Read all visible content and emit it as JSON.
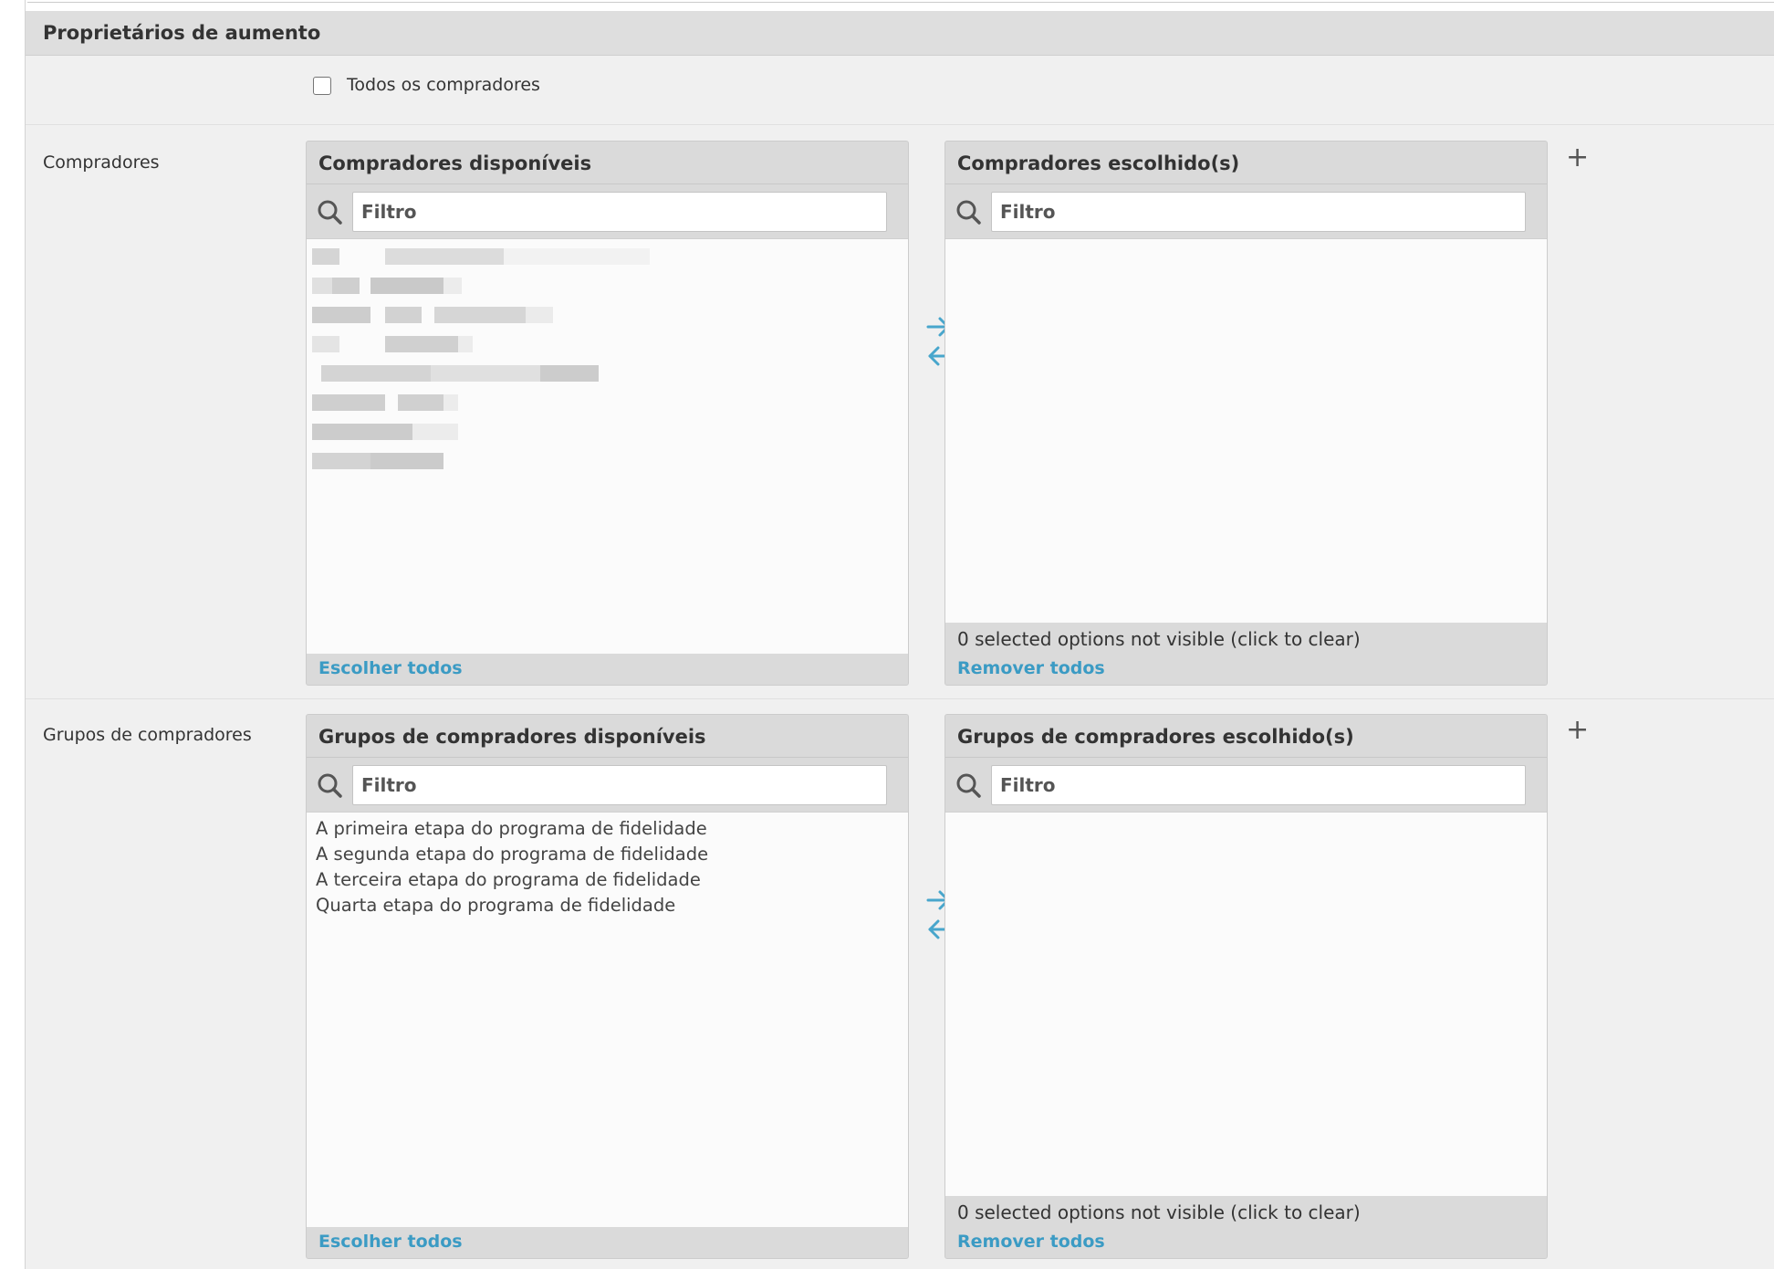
{
  "fieldset": {
    "title": "Proprietários de aumento"
  },
  "all_buyers": {
    "label": "Todos os compradores",
    "checked": false
  },
  "buyers": {
    "row_label": "Compradores",
    "available": {
      "title": "Compradores disponíveis",
      "filter_placeholder": "Filtro",
      "items_redacted": true,
      "choose_all": "Escolher todos"
    },
    "chosen": {
      "title": "Compradores escolhido(s)",
      "filter_placeholder": "Filtro",
      "hidden_note": "0 selected options not visible (click to clear)",
      "remove_all": "Remover todos"
    }
  },
  "buyer_groups": {
    "row_label": "Grupos de compradores",
    "available": {
      "title": "Grupos de compradores disponíveis",
      "filter_placeholder": "Filtro",
      "items": [
        "A primeira etapa do programa de fidelidade",
        "A segunda etapa do programa de fidelidade",
        "A terceira etapa do programa de fidelidade",
        "Quarta etapa do programa de fidelidade"
      ],
      "choose_all": "Escolher todos"
    },
    "chosen": {
      "title": "Grupos de compradores escolhido(s)",
      "filter_placeholder": "Filtro",
      "hidden_note": "0 selected options not visible (click to clear)",
      "remove_all": "Remover todos"
    }
  },
  "icons": {
    "search": "search-icon",
    "move_right": "arrow-right-icon",
    "move_left": "arrow-left-icon",
    "add": "plus-icon"
  },
  "colors": {
    "link": "#3b9bc4",
    "header_bg": "#dedede",
    "panel_bg": "#f0f0f0",
    "list_bg": "#fbfbfb"
  }
}
